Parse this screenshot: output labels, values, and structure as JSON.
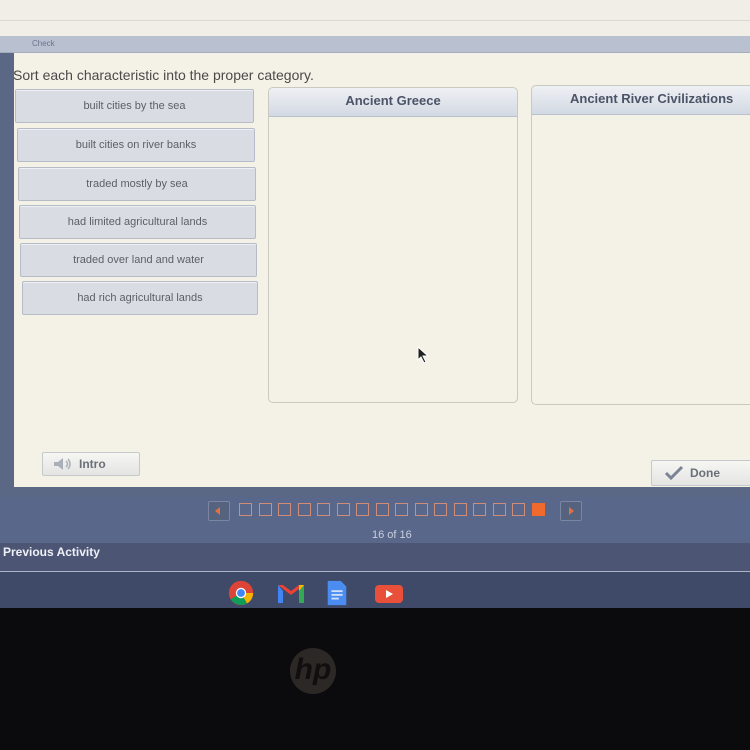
{
  "top_bar": {
    "check_label": "Check"
  },
  "activity": {
    "instruction": "Sort each characteristic into the proper category.",
    "cards": [
      {
        "label": "built cities by the sea"
      },
      {
        "label": "built cities on river banks"
      },
      {
        "label": "traded mostly by sea"
      },
      {
        "label": "had limited agricultural lands"
      },
      {
        "label": "traded over land and water"
      },
      {
        "label": "had rich agricultural lands"
      }
    ],
    "categories": [
      {
        "title": "Ancient Greece",
        "items": []
      },
      {
        "title": "Ancient River Civilizations",
        "items": []
      }
    ],
    "intro_button": {
      "label": "Intro",
      "icon": "speaker-icon"
    },
    "done_button": {
      "label": "Done",
      "icon": "checkmark-icon"
    }
  },
  "navigation": {
    "prev_icon": "arrow-left-icon",
    "next_icon": "arrow-right-icon",
    "total_pages": 16,
    "current_page": 16,
    "page_label": "16 of 16",
    "accent_color": "#f06a2e"
  },
  "footer": {
    "previous_activity_label": "Previous Activity"
  },
  "taskbar": {
    "apps": [
      {
        "name": "Chrome",
        "icon": "chrome-icon"
      },
      {
        "name": "Gmail",
        "icon": "gmail-icon"
      },
      {
        "name": "Docs",
        "icon": "docs-icon"
      },
      {
        "name": "YouTube",
        "icon": "youtube-icon"
      }
    ]
  },
  "bezel": {
    "brand": "hp"
  }
}
